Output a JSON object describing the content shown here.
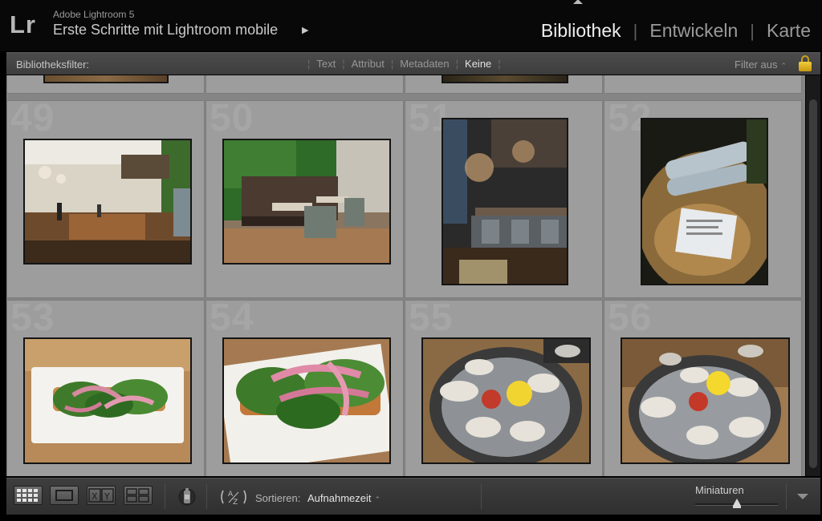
{
  "header": {
    "logo": "Lr",
    "app_name": "Adobe Lightroom 5",
    "catalog_name": "Erste Schritte mit Lightroom mobile",
    "catalog_arrow": "▶",
    "modules": [
      "Bibliothek",
      "Entwickeln",
      "Karte"
    ],
    "active_module": "Bibliothek"
  },
  "filter_bar": {
    "label": "Bibliotheksfilter:",
    "options": [
      "Text",
      "Attribut",
      "Metadaten",
      "Keine"
    ],
    "active_option": "Keine",
    "filter_state": "Filter aus",
    "lock_icon": "lock-icon"
  },
  "grid": {
    "cells": [
      {
        "index": "49",
        "subject": "restaurant interior with open kitchen"
      },
      {
        "index": "50",
        "subject": "banquette seating with green wall"
      },
      {
        "index": "51",
        "subject": "bar with high stools and chandeliers"
      },
      {
        "index": "52",
        "subject": "napkins and menu on wooden table"
      },
      {
        "index": "53",
        "subject": "toast with greens and pickled onion"
      },
      {
        "index": "54",
        "subject": "toast with greens close-up"
      },
      {
        "index": "55",
        "subject": "oysters platter with lemon"
      },
      {
        "index": "56",
        "subject": "oysters on ice"
      }
    ]
  },
  "toolbar": {
    "view_buttons": [
      "grid-view-icon",
      "loupe-view-icon",
      "compare-view-icon",
      "survey-view-icon"
    ],
    "spray_icon": "painter-spray-icon",
    "sort_icon": "sort-direction-icon",
    "sort_label": "Sortieren:",
    "sort_value": "Aufnahmezeit",
    "thumbnail_label": "Miniaturen",
    "thumbnail_size": 0.5,
    "menu_icon": "toolbar-menu-icon"
  },
  "colors": {
    "accent_lock": "#e0b52a",
    "grid_cell": "#9d9d9d",
    "background": "#000000"
  }
}
